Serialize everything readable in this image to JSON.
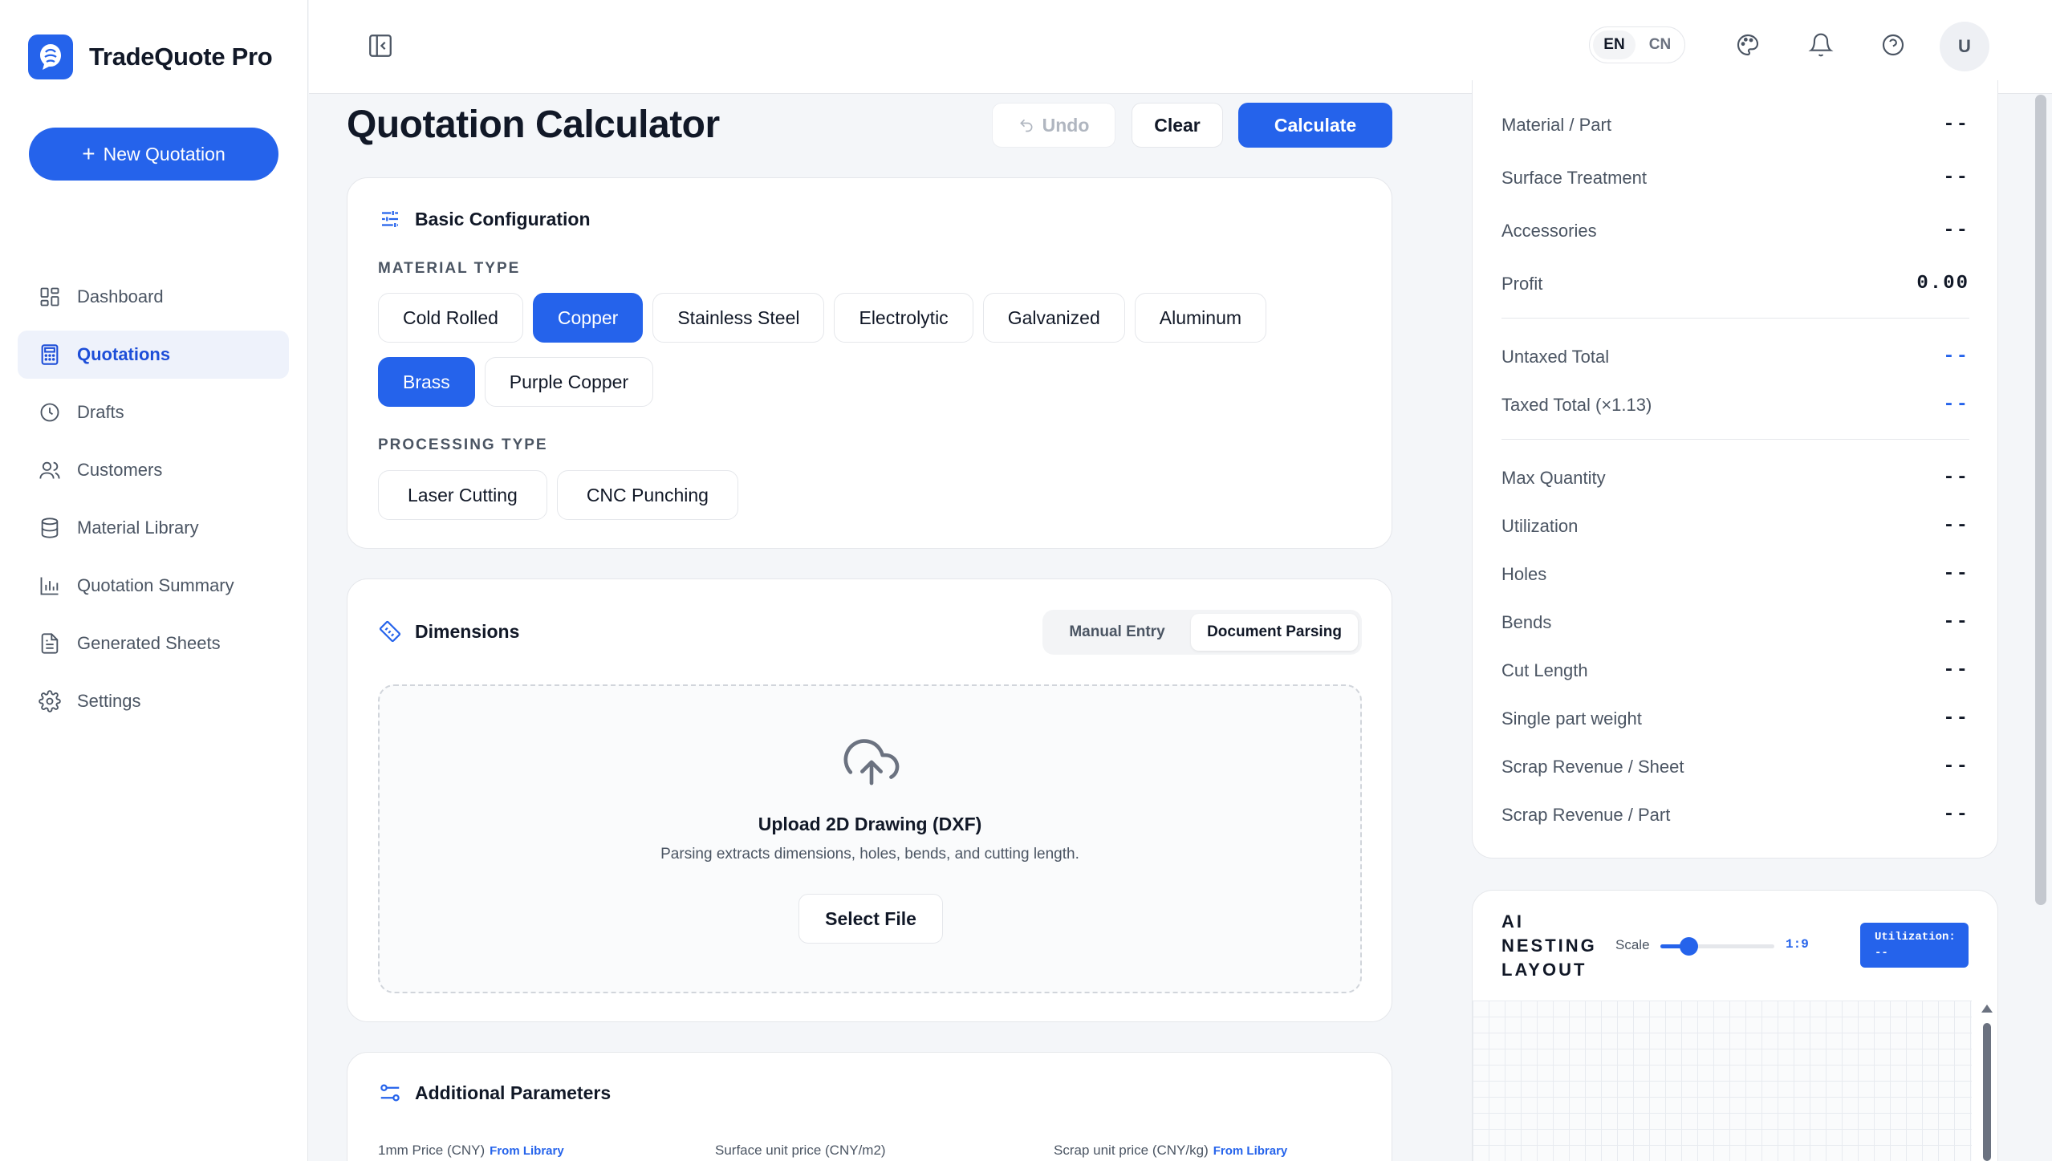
{
  "brand": {
    "name": "TradeQuote Pro",
    "logo_icon": "lion-icon"
  },
  "sidebar": {
    "new_button": "New Quotation",
    "items": [
      {
        "label": "Dashboard",
        "icon": "dashboard-icon"
      },
      {
        "label": "Quotations",
        "icon": "calculator-icon",
        "active": true
      },
      {
        "label": "Drafts",
        "icon": "clock-icon"
      },
      {
        "label": "Customers",
        "icon": "users-icon"
      },
      {
        "label": "Material Library",
        "icon": "database-icon"
      },
      {
        "label": "Quotation Summary",
        "icon": "bar-chart-icon"
      },
      {
        "label": "Generated Sheets",
        "icon": "file-icon"
      },
      {
        "label": "Settings",
        "icon": "gear-icon"
      }
    ]
  },
  "topbar": {
    "lang_en": "EN",
    "lang_cn": "CN",
    "avatar": "U"
  },
  "main": {
    "title": "Quotation Calculator",
    "undo": "Undo",
    "clear": "Clear",
    "calculate": "Calculate",
    "basic": {
      "title": "Basic Configuration",
      "material_label": "MATERIAL TYPE",
      "materials": [
        "Cold Rolled",
        "Copper",
        "Stainless Steel",
        "Electrolytic",
        "Galvanized",
        "Aluminum",
        "Brass",
        "Purple Copper"
      ],
      "processing_label": "PROCESSING TYPE",
      "processing": [
        "Laser Cutting",
        "CNC Punching"
      ]
    },
    "dimensions": {
      "title": "Dimensions",
      "tab_manual": "Manual Entry",
      "tab_doc": "Document Parsing",
      "upload_title": "Upload 2D Drawing (DXF)",
      "upload_sub": "Parsing extracts dimensions, holes, bends, and cutting length.",
      "select_file": "Select File"
    },
    "additional": {
      "title": "Additional Parameters",
      "price_label": "1mm Price (CNY)",
      "surface_label": "Surface unit price (CNY/m2)",
      "scrap_label": "Scrap unit price (CNY/kg)",
      "from_library": "From Library"
    }
  },
  "summary": {
    "rows1": [
      {
        "label": "Material / Part",
        "value": "--"
      },
      {
        "label": "Surface Treatment",
        "value": "--"
      },
      {
        "label": "Accessories",
        "value": "--"
      },
      {
        "label": "Profit",
        "value": "0.00"
      }
    ],
    "rows2": [
      {
        "label": "Untaxed Total",
        "value": "--"
      },
      {
        "label": "Taxed Total (×1.13)",
        "value": "--"
      }
    ],
    "rows3": [
      {
        "label": "Max Quantity",
        "value": "--"
      },
      {
        "label": "Utilization",
        "value": "--"
      },
      {
        "label": "Holes",
        "value": "--"
      },
      {
        "label": "Bends",
        "value": "--"
      },
      {
        "label": "Cut Length",
        "value": "--"
      },
      {
        "label": "Single part weight",
        "value": "--"
      },
      {
        "label": "Scrap Revenue / Sheet",
        "value": "--"
      },
      {
        "label": "Scrap Revenue / Part",
        "value": "--"
      }
    ]
  },
  "nesting": {
    "title": "AI NESTING LAYOUT",
    "scale_label": "Scale",
    "scale_value": "1:9",
    "scale_fraction": 0.2,
    "util_label": "Utilization:",
    "util_value": "--"
  },
  "colors": {
    "accent": "#2563eb"
  }
}
